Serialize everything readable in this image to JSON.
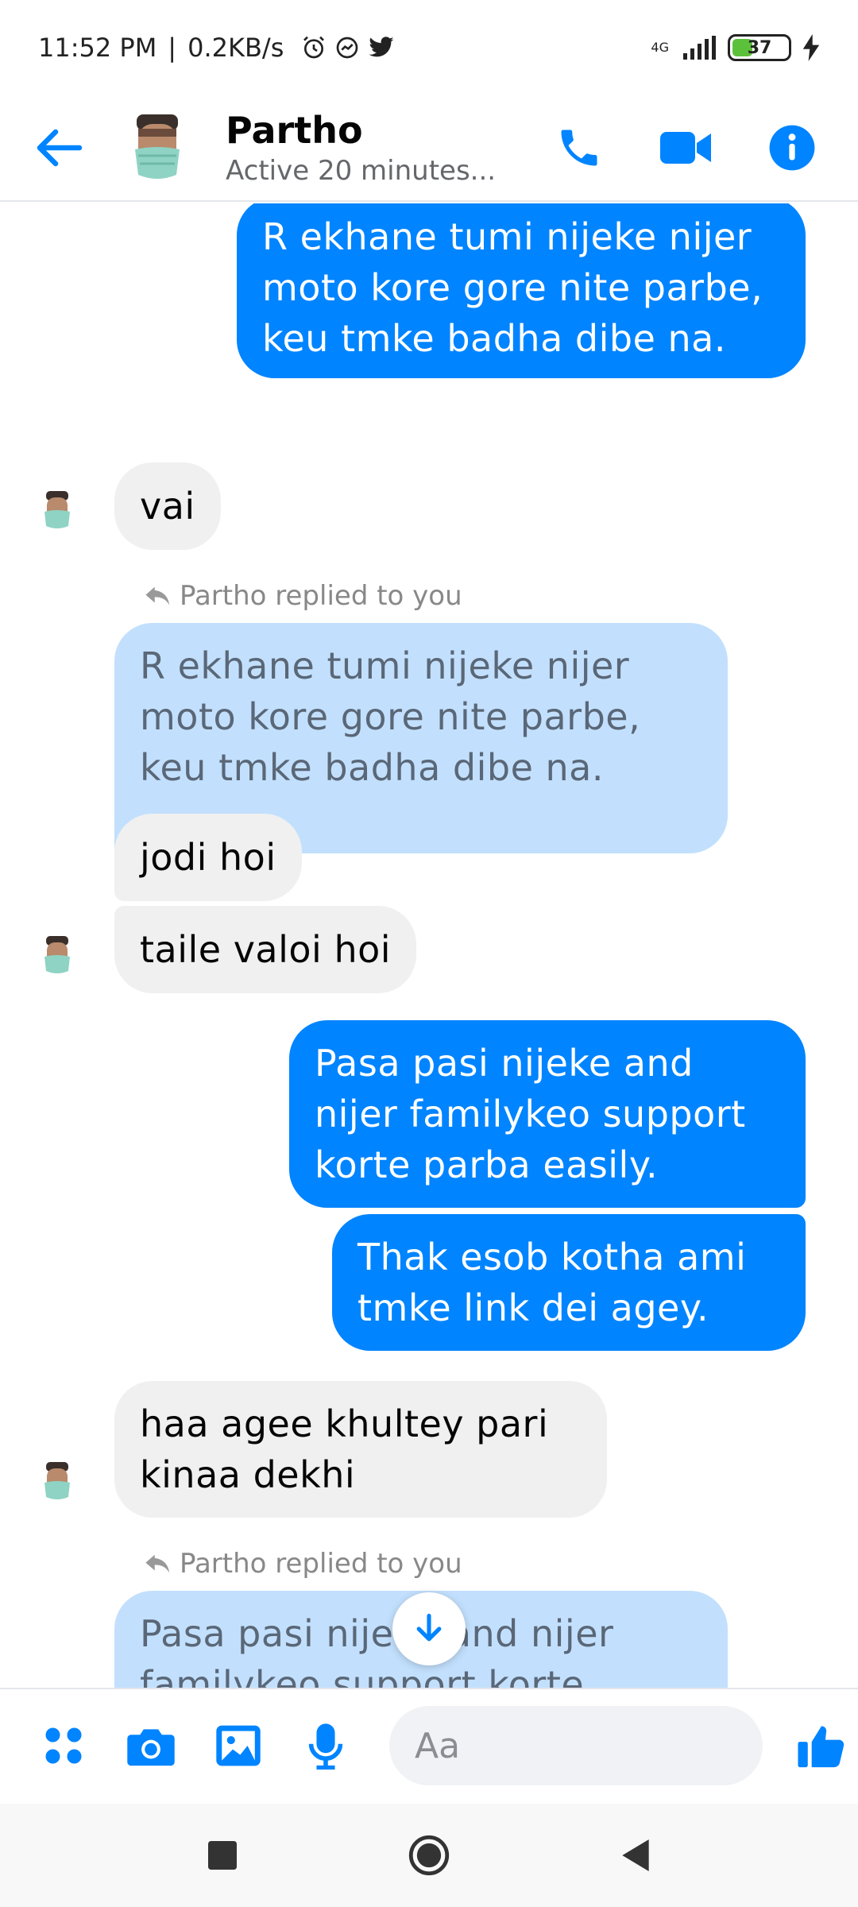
{
  "status_bar": {
    "time": "11:52 PM",
    "separator": "|",
    "speed": "0.2KB/s",
    "network": "4G",
    "battery": "37"
  },
  "header": {
    "name": "Partho",
    "status": "Active 20 minutes..."
  },
  "messages": [
    {
      "type": "outgoing",
      "text": "R ekhane tumi nijeke nijer moto kore gore nite parbe, keu tmke badha dibe na."
    },
    {
      "type": "incoming",
      "text": "vai"
    },
    {
      "type": "reply_label",
      "text": "Partho replied to you"
    },
    {
      "type": "quoted",
      "text": "R ekhane tumi nijeke nijer moto kore gore nite parbe, keu tmke badha dibe na."
    },
    {
      "type": "incoming",
      "text": "jodi hoi"
    },
    {
      "type": "incoming",
      "text": "taile valoi hoi"
    },
    {
      "type": "outgoing",
      "text": "Pasa pasi nijeke and nijer familykeo support korte parba easily."
    },
    {
      "type": "outgoing",
      "text": "Thak esob kotha ami tmke link dei agey."
    },
    {
      "type": "incoming",
      "text": "haa agee khultey pari kinaa dekhi"
    },
    {
      "type": "reply_label",
      "text": "Partho replied to you"
    },
    {
      "type": "quoted",
      "text": "Pasa pasi nijeke and nijer familykeo support korte"
    }
  ],
  "composer": {
    "placeholder": "Aa"
  },
  "colors": {
    "accent": "#0084ff",
    "outgoing_bubble": "#0084ff",
    "incoming_bubble": "#f0f0f0",
    "quoted_bubble": "#c2e0fd"
  },
  "icons": [
    "back-arrow-icon",
    "phone-icon",
    "video-icon",
    "info-icon",
    "menu-dots-icon",
    "camera-icon",
    "gallery-icon",
    "microphone-icon",
    "emoji-icon",
    "thumbs-up-icon",
    "arrow-down-icon",
    "reply-icon",
    "alarm-icon",
    "twitter-icon"
  ]
}
